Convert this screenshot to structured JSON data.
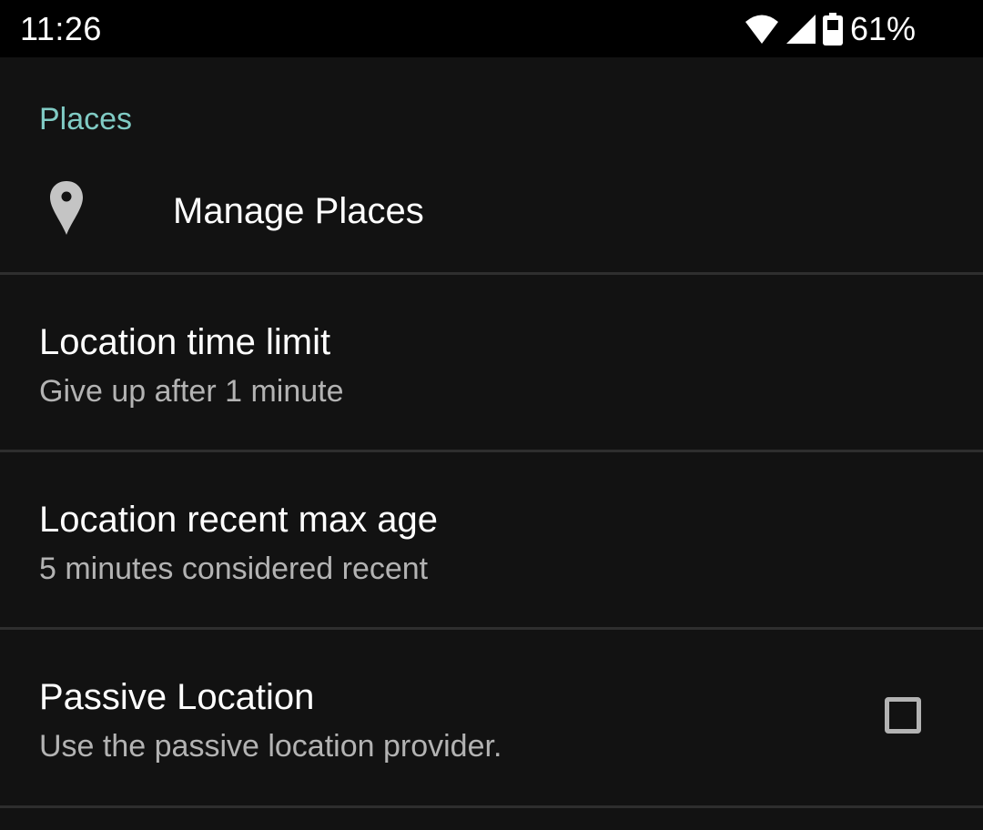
{
  "status_bar": {
    "time": "11:26",
    "battery_percent": "61%",
    "icons": [
      "wifi-icon",
      "cell-signal-icon",
      "battery-icon"
    ]
  },
  "category": {
    "title": "Places",
    "accent_color": "#80cbc4"
  },
  "preferences": [
    {
      "title": "Manage Places",
      "icon": "location-pin-icon"
    },
    {
      "title": "Location time limit",
      "summary": "Give up after 1 minute"
    },
    {
      "title": "Location recent max age",
      "summary": "5 minutes considered recent"
    },
    {
      "title": "Passive Location",
      "summary": "Use the passive location provider.",
      "checked": false
    }
  ]
}
